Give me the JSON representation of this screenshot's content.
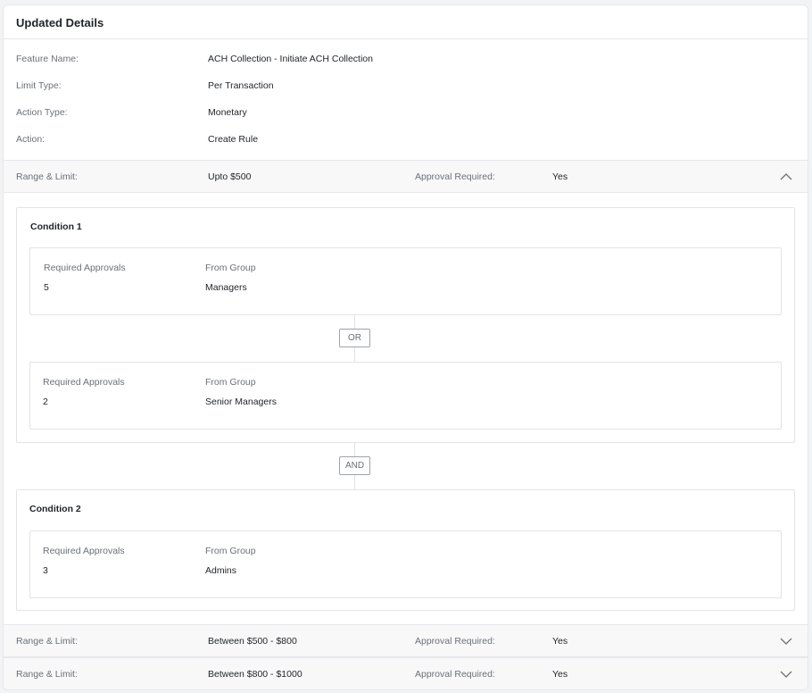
{
  "header": {
    "title": "Updated Details"
  },
  "details": [
    {
      "label": "Feature Name:",
      "value": "ACH Collection - Initiate ACH Collection"
    },
    {
      "label": "Limit Type:",
      "value": "Per Transaction"
    },
    {
      "label": "Action Type:",
      "value": "Monetary"
    },
    {
      "label": "Action:",
      "value": "Create Rule"
    }
  ],
  "ranges": [
    {
      "range_label": "Range & Limit:",
      "range_value": "Upto $500",
      "approval_label": "Approval Required:",
      "approval_value": "Yes",
      "expanded": true
    },
    {
      "range_label": "Range & Limit:",
      "range_value": "Between $500 - $800",
      "approval_label": "Approval Required:",
      "approval_value": "Yes",
      "expanded": false
    },
    {
      "range_label": "Range & Limit:",
      "range_value": "Between $800 - $1000",
      "approval_label": "Approval Required:",
      "approval_value": "Yes",
      "expanded": false
    }
  ],
  "conditions": [
    {
      "title": "Condition 1",
      "approvals": [
        {
          "req_label": "Required Approvals",
          "req_value": "5",
          "group_label": "From Group",
          "group_value": "Managers"
        },
        {
          "req_label": "Required Approvals",
          "req_value": "2",
          "group_label": "From Group",
          "group_value": "Senior Managers"
        }
      ],
      "inner_operator": "OR"
    },
    {
      "title": "Condition 2",
      "approvals": [
        {
          "req_label": "Required Approvals",
          "req_value": "3",
          "group_label": "From Group",
          "group_value": "Admins"
        }
      ]
    }
  ],
  "condition_operator": "AND",
  "icons": {
    "expanded": "chevron-up-icon",
    "collapsed": "chevron-down-icon"
  },
  "colors": {
    "border": "#e2e3e6",
    "label": "#6b7078",
    "row_bg": "#f8f8f9"
  }
}
